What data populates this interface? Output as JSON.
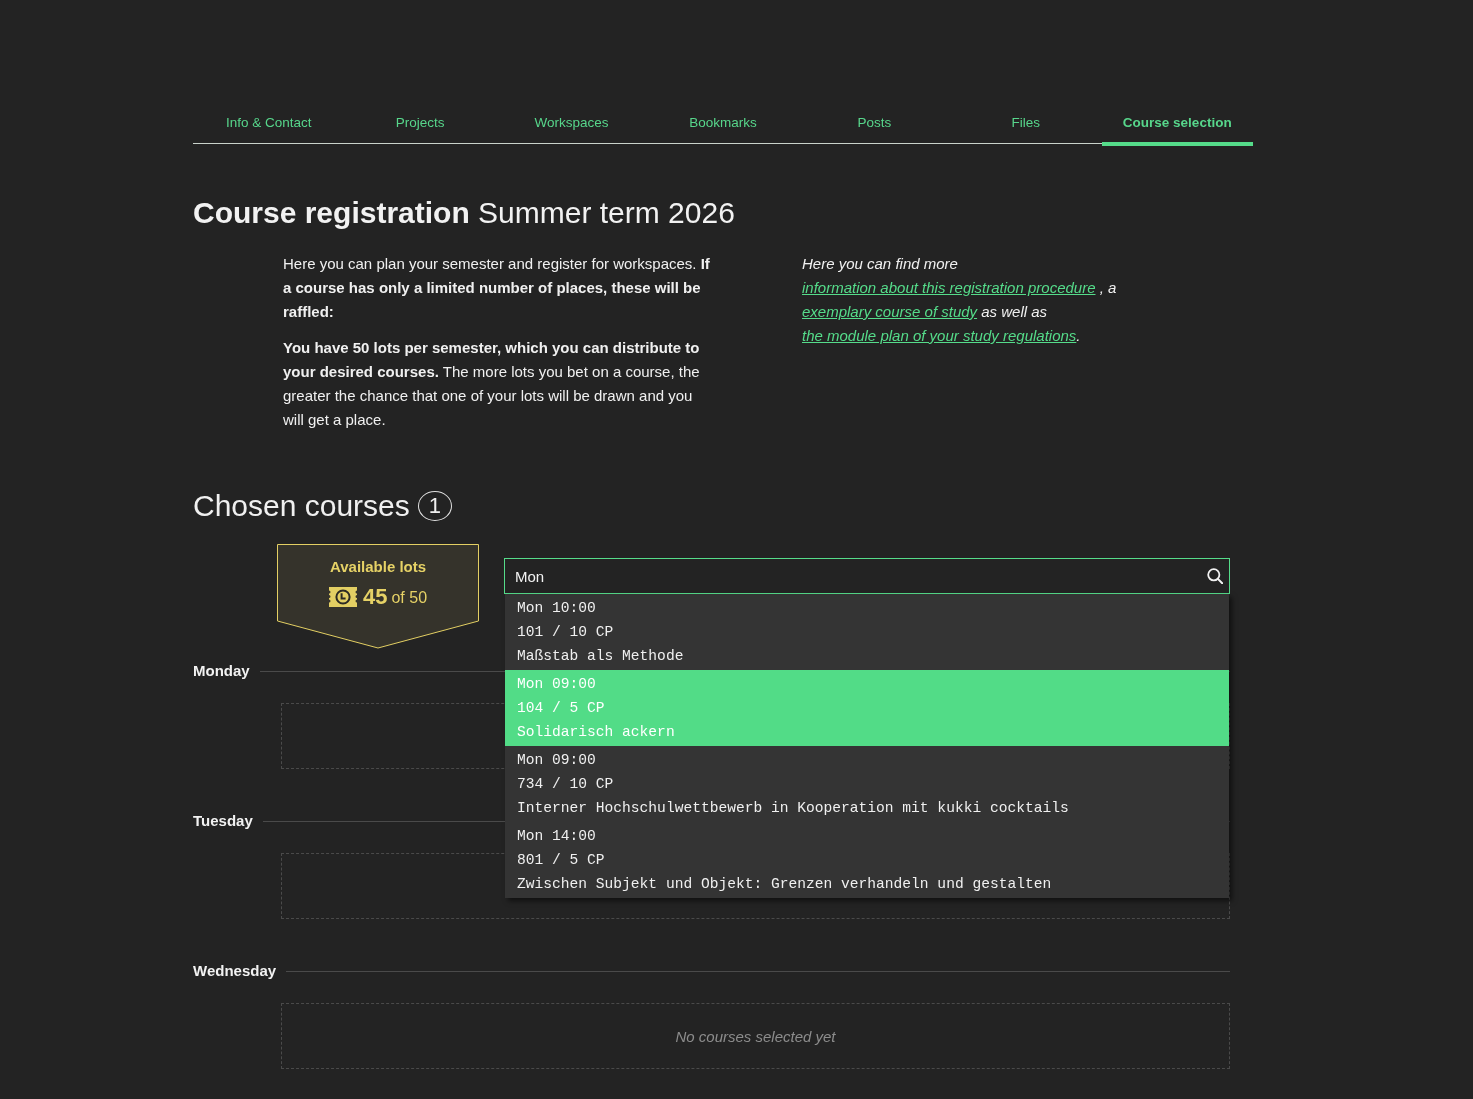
{
  "tabs": [
    {
      "label": "Info & Contact",
      "selected": false
    },
    {
      "label": "Projects",
      "selected": false
    },
    {
      "label": "Workspaces",
      "selected": false
    },
    {
      "label": "Bookmarks",
      "selected": false
    },
    {
      "label": "Posts",
      "selected": false
    },
    {
      "label": "Files",
      "selected": false
    },
    {
      "label": "Course selection",
      "selected": true
    }
  ],
  "title": "**Course registration** Summer term 2026",
  "intro": {
    "paragraphs": [
      "Here you can plan your semester and register for workspaces. **If a course has only a limited number of places, these will be raffled:**",
      "**You have 50 lots per semester, which you can distribute to your desired courses.** The more lots you bet on a course, the greater the chance that one of your lots will be drawn and you will get a place."
    ],
    "info": [
      {
        "kind": "text",
        "text": "Here you can find more "
      },
      {
        "kind": "link",
        "text": "information about this registration procedure"
      },
      {
        "kind": "text",
        "text": " , a "
      },
      {
        "kind": "link",
        "text": "exemplary course of study"
      },
      {
        "kind": "text",
        "text": " as well as "
      },
      {
        "kind": "link",
        "text": "the module plan of your study regulations"
      },
      {
        "kind": "text",
        "text": "."
      }
    ]
  },
  "chosen_courses": {
    "heading": "Chosen courses",
    "count": "1"
  },
  "lots": {
    "label": "Available lots",
    "available": "45",
    "total": "of 50"
  },
  "search": {
    "value": "Mon",
    "results": [
      {
        "time": "Mon 10:00",
        "code": "101 / 10 CP",
        "title": "Maßstab als Methode",
        "selected": false
      },
      {
        "time": "Mon 09:00",
        "code": "104 / 5 CP",
        "title": "Solidarisch ackern",
        "selected": true
      },
      {
        "time": "Mon 09:00",
        "code": "734 / 10 CP",
        "title": "Interner Hochschulwettbewerb in Kooperation mit kukki cocktails",
        "selected": false
      },
      {
        "time": "Mon 14:00",
        "code": "801 / 5 CP",
        "title": "Zwischen Subjekt und Objekt: Grenzen verhandeln und gestalten",
        "selected": false
      }
    ]
  },
  "days": [
    {
      "label": "Monday"
    },
    {
      "label": "Tuesday"
    },
    {
      "label": "Wednesday",
      "empty_message": "No courses selected yet"
    }
  ]
}
